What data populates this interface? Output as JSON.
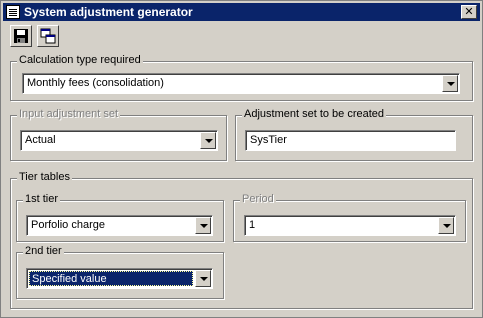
{
  "window": {
    "title": "System adjustment generator",
    "close_label": "✕"
  },
  "toolbar": {
    "save_icon": "floppy-disk-icon",
    "copy_icon": "copy-windows-icon"
  },
  "calculation": {
    "legend": "Calculation type required",
    "value": "Monthly fees (consolidation)"
  },
  "input_set": {
    "legend": "Input adjustment set",
    "value": "Actual",
    "disabled": true
  },
  "output_set": {
    "legend": "Adjustment set to be created",
    "value": "SysTier"
  },
  "tier_tables": {
    "legend": "Tier tables",
    "first_tier": {
      "legend": "1st tier",
      "value": "Porfolio charge"
    },
    "period": {
      "legend": "Period",
      "value": "1",
      "disabled": true
    },
    "second_tier": {
      "legend": "2nd tier",
      "value": "Specified value"
    }
  },
  "colors": {
    "title_bar": "#0a246a",
    "face": "#d4d0c8",
    "selection": "#0a246a"
  }
}
